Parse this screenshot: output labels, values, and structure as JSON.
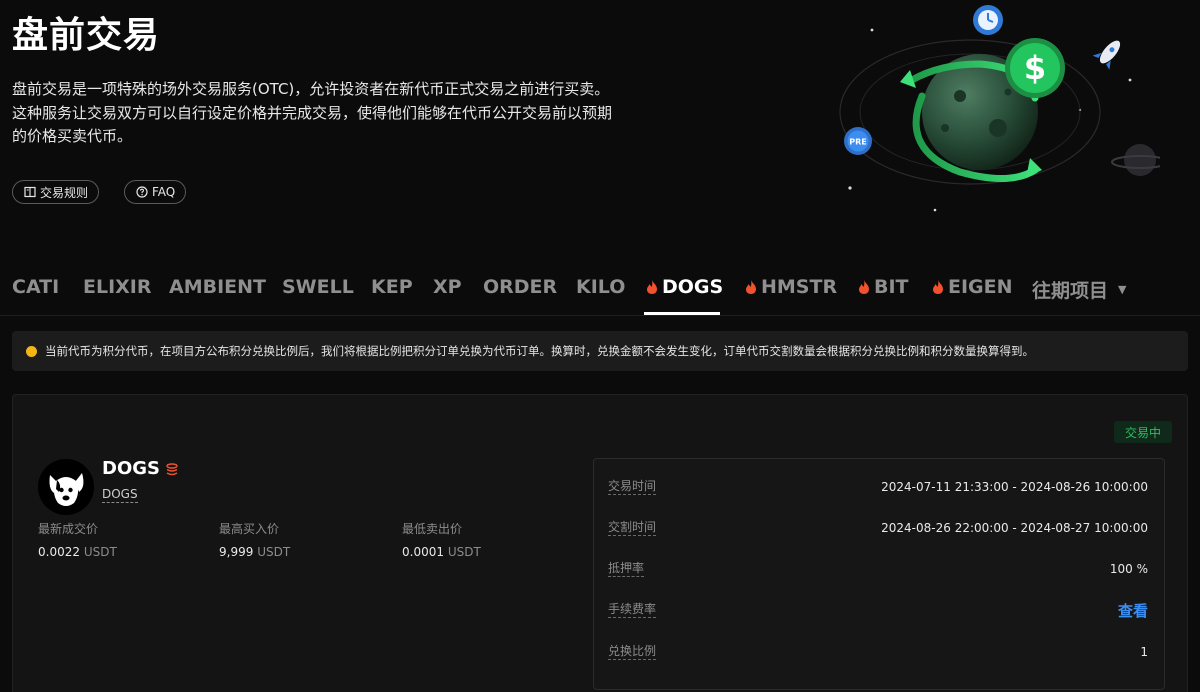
{
  "hero": {
    "title": "盘前交易",
    "description": "盘前交易是一项特殊的场外交易服务(OTC)，允许投资者在新代币正式交易之前进行买卖。这种服务让交易双方可以自行设定价格并完成交易，使得他们能够在代币公开交易前以预期的价格买卖代币。",
    "rules_button": "交易规则",
    "faq_button": "FAQ",
    "illustration_badges": {
      "pre": "PRE",
      "dollar": "$"
    }
  },
  "tabs": [
    {
      "label": "CATI",
      "hot": false,
      "active": false
    },
    {
      "label": "ELIXIR",
      "hot": false,
      "active": false
    },
    {
      "label": "AMBIENT",
      "hot": false,
      "active": false
    },
    {
      "label": "SWELL",
      "hot": false,
      "active": false
    },
    {
      "label": "KEP",
      "hot": false,
      "active": false
    },
    {
      "label": "XP",
      "hot": false,
      "active": false
    },
    {
      "label": "ORDER",
      "hot": false,
      "active": false
    },
    {
      "label": "KILO",
      "hot": false,
      "active": false
    },
    {
      "label": "DOGS",
      "hot": true,
      "active": true
    },
    {
      "label": "HMSTR",
      "hot": true,
      "active": false
    },
    {
      "label": "BIT",
      "hot": true,
      "active": false
    },
    {
      "label": "EIGEN",
      "hot": true,
      "active": false
    },
    {
      "label": "往期项目",
      "hot": false,
      "active": false,
      "dropdown": true
    }
  ],
  "notice": "当前代币为积分代币，在项目方公布积分兑换比例后，我们将根据比例把积分订单兑换为代币订单。换算时，兑换金额不会发生变化，订单代币交割数量会根据积分兑换比例和积分数量换算得到。",
  "card": {
    "status": "交易中",
    "token_name": "DOGS",
    "token_sub": "DOGS",
    "stats": [
      {
        "label": "最新成交价",
        "value": "0.0022",
        "unit": "USDT"
      },
      {
        "label": "最高买入价",
        "value": "9,999",
        "unit": "USDT"
      },
      {
        "label": "最低卖出价",
        "value": "0.0001",
        "unit": "USDT"
      }
    ],
    "info": [
      {
        "key": "交易时间",
        "value": "2024-07-11 21:33:00 - 2024-08-26 10:00:00"
      },
      {
        "key": "交割时间",
        "value": "2024-08-26 22:00:00 - 2024-08-27 10:00:00"
      },
      {
        "key": "抵押率",
        "value": "100 %"
      },
      {
        "key": "手续费率",
        "value": "查看",
        "link": true
      },
      {
        "key": "兑换比例",
        "value": "1"
      }
    ]
  },
  "colors": {
    "accent_green": "#2fbd5f",
    "link_blue": "#3d8cf0",
    "warning_yellow": "#f5b516",
    "hot_red": "#f0522e"
  }
}
